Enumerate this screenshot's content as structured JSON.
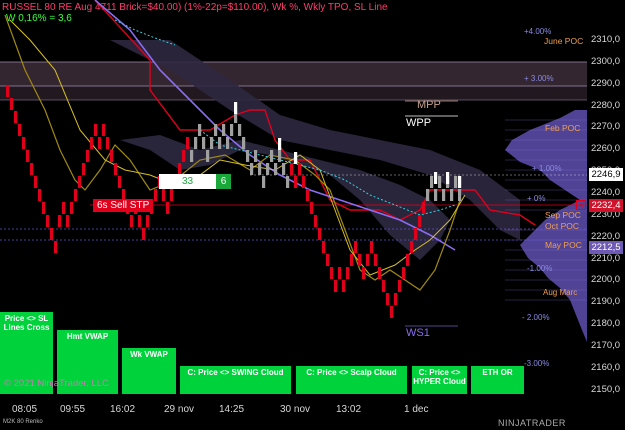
{
  "header": {
    "title": "RUSSEL 80 RE Aug 4711 Brick=$40.00) (1%-22p=$110.00), Wk %, Wkly TPO, SL Line",
    "subtitle": "W 0,16% = 3,6"
  },
  "y_axis": {
    "ticks": [
      "2310,0",
      "2300,0",
      "2290,0",
      "2280,0",
      "2270,0",
      "2260,0",
      "2250,0",
      "2240,0",
      "2230,0",
      "2220,0",
      "2210,0",
      "2200,0",
      "2190,0",
      "2180,0",
      "2170,0",
      "2160,0",
      "2150,0"
    ],
    "price_markers": [
      {
        "label": "2246,9",
        "bg": "#ffffff",
        "fg": "#000000"
      },
      {
        "label": "2232,4",
        "bg": "#d0122b",
        "fg": "#ffffff"
      },
      {
        "label": "2212,5",
        "bg": "#6e5ab4",
        "fg": "#ffffff"
      }
    ]
  },
  "x_axis": {
    "ticks": [
      "08:05",
      "09:55",
      "16:02",
      "29 nov",
      "14:25",
      "30 nov",
      "13:02",
      "1 dec"
    ]
  },
  "chart_labels": {
    "percent_levels": [
      "+4.00%",
      "+ 3.00%",
      "+ 1.00%",
      "+ 0%",
      "-1.00%",
      "- 2.00%",
      "-3.00%"
    ],
    "poc_labels": [
      "June POC",
      "Feb POC",
      "Sep POC",
      "Oct POC",
      "May POC",
      "Aug Marc"
    ],
    "pivots": [
      "MPP",
      "WPP",
      "WS1"
    ],
    "sell_stop": "6s  Sell STP",
    "counter_left": "33",
    "counter_right": "6"
  },
  "buttons": [
    {
      "name": "price-sl-lines-cross-button",
      "label": "Price <> SL Lines Cross"
    },
    {
      "name": "hmt-vwap-button",
      "label": "Hmt VWAP"
    },
    {
      "name": "wk-vwap-button",
      "label": "Wk VWAP"
    },
    {
      "name": "price-swing-cloud-button",
      "label": "C: Price <> SWING Cloud"
    },
    {
      "name": "price-scalp-cloud-button",
      "label": "C: Price <> Scalp Cloud"
    },
    {
      "name": "price-hyper-cloud-button",
      "label": "C: Price <> HYPER Cloud"
    },
    {
      "name": "eth-or-button",
      "label": "ETH OR"
    }
  ],
  "footer": {
    "copyright": "© 2021 NinjaTrader, LLC",
    "instrument": "M2K 80 Renko",
    "brand": "NINJATRADER"
  },
  "colors": {
    "up_brick": "#a0a0a0",
    "down_brick": "#e0001c",
    "sl_line": "#e0001c",
    "vwap": "#8a6cf0",
    "scalp_line": "#29d6e6",
    "swing_line": "#d8c020",
    "tpo_profile": "#6e5ab4",
    "button_bg": "#00d23c"
  }
}
